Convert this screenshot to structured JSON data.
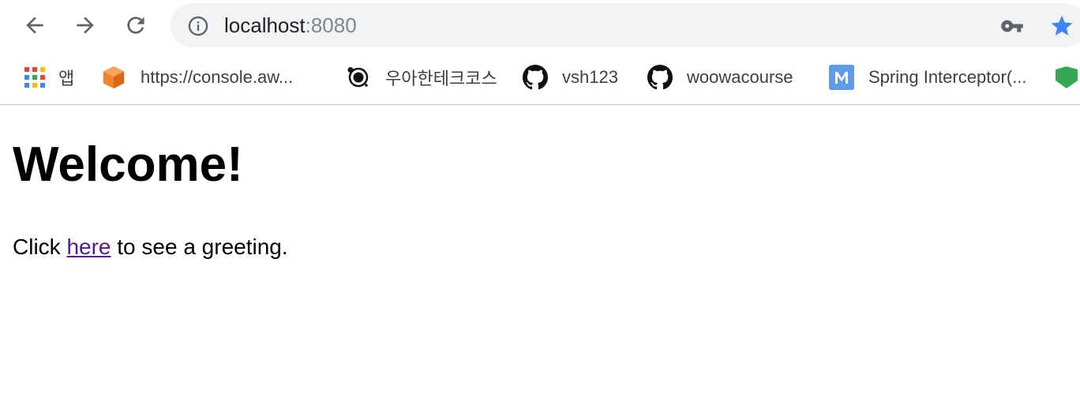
{
  "browser": {
    "address_bar": {
      "host": "localhost",
      "port": ":8080"
    },
    "bookmarks": [
      {
        "label": "앱",
        "icon": "apps-grid-icon"
      },
      {
        "label": "https://console.aw...",
        "icon": "aws-cube-icon"
      },
      {
        "label": "우아한테크코스",
        "icon": "woowa-icon"
      },
      {
        "label": "vsh123",
        "icon": "github-icon"
      },
      {
        "label": "woowacourse",
        "icon": "github-icon"
      },
      {
        "label": "Spring Interceptor(...",
        "icon": "medium-m-icon"
      }
    ],
    "colors": {
      "omnibox_bg": "#f1f3f4",
      "star_blue": "#4285f4",
      "aws_orange": "#f0822d",
      "medium_blue": "#5f9be8"
    }
  },
  "page": {
    "heading": "Welcome!",
    "greeting": {
      "before": "Click ",
      "link": "here",
      "after": " to see a greeting."
    },
    "link_color": "#551a8b"
  }
}
